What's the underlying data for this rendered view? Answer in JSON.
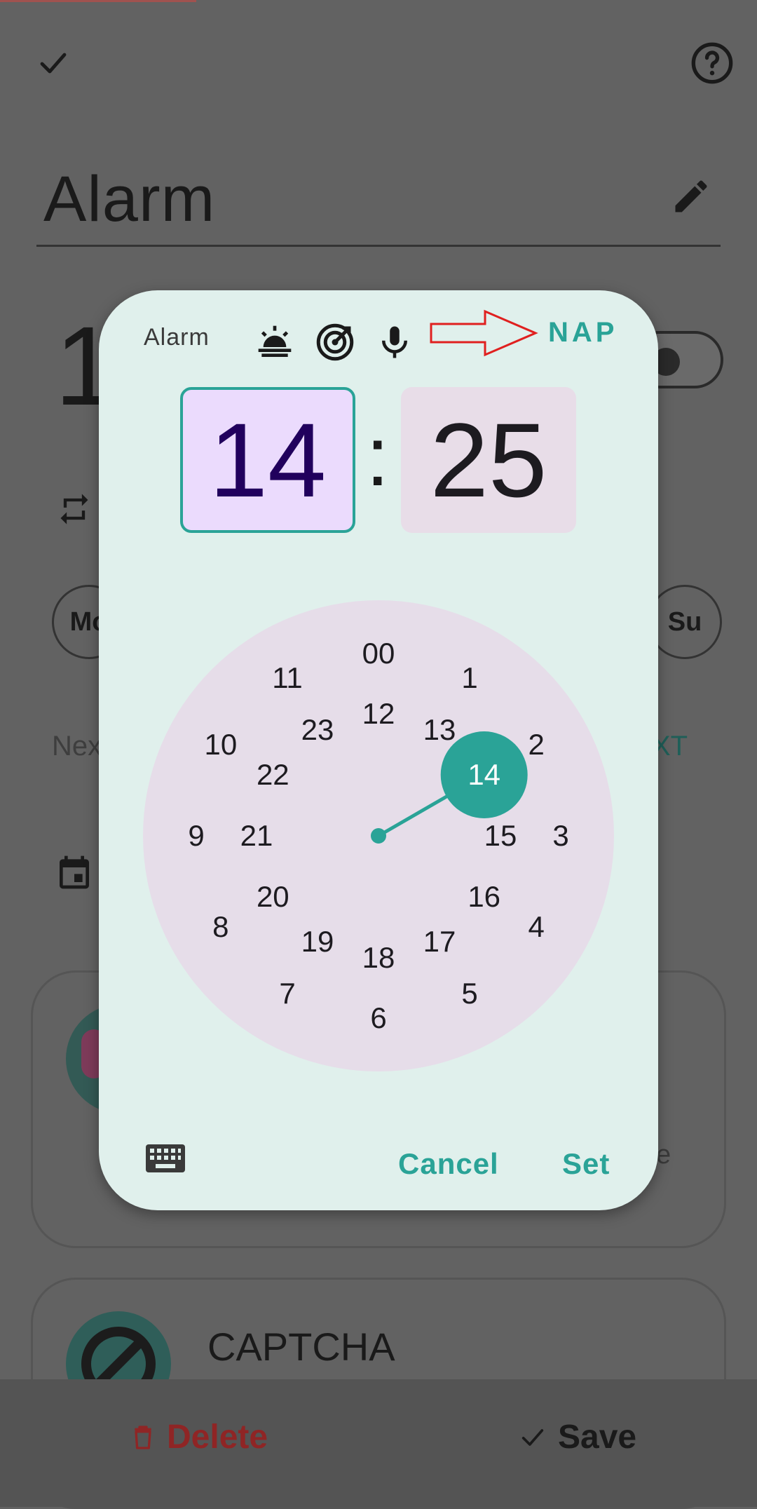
{
  "screen": {
    "title": "Alarm",
    "time_partial": "1",
    "days": {
      "monday_partial": "Mo",
      "sunday": "Su"
    },
    "next_partial": "Nex",
    "next_right_partial": "XT",
    "card_right_partial": "e",
    "captcha_label": "CAPTCHA",
    "delete_label": "Delete",
    "save_label": "Save"
  },
  "dialog": {
    "label": "Alarm",
    "nap_label": "NAP",
    "hour": "14",
    "separator": ":",
    "minute": "25",
    "clock": {
      "outer": [
        "00",
        "1",
        "2",
        "3",
        "4",
        "5",
        "6",
        "7",
        "8",
        "9",
        "10",
        "11"
      ],
      "inner": [
        "12",
        "13",
        "14",
        "15",
        "16",
        "17",
        "18",
        "19",
        "20",
        "21",
        "22",
        "23"
      ],
      "selected": "14"
    },
    "cancel_label": "Cancel",
    "set_label": "Set"
  },
  "colors": {
    "accent": "#2aa397",
    "annotation_arrow": "#e0201f",
    "delete": "#8f2525"
  },
  "icons": [
    "check-icon",
    "help-icon",
    "edit-icon",
    "repeat-icon",
    "calendar-icon",
    "sunrise-icon",
    "target-icon",
    "mic-icon",
    "keyboard-icon",
    "trash-icon",
    "captcha-blocked-icon"
  ]
}
